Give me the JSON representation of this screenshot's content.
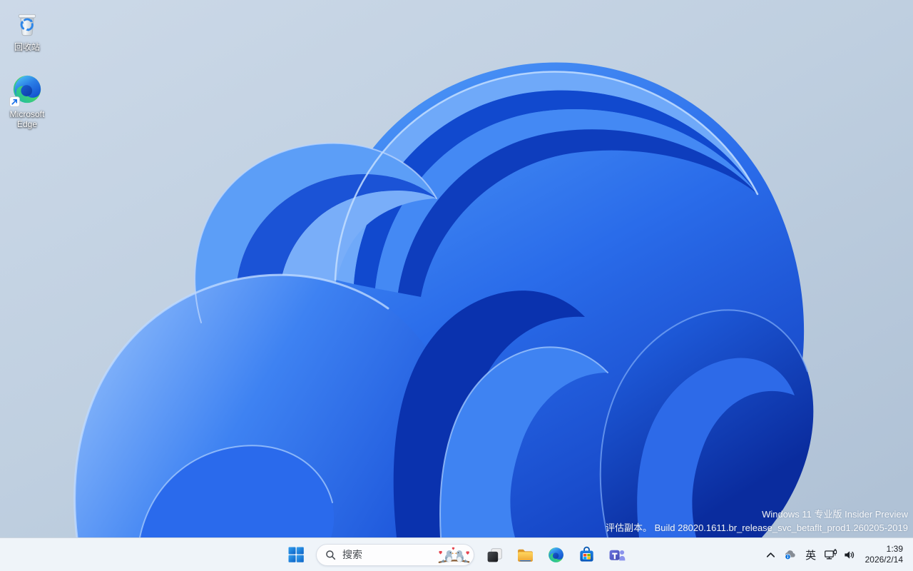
{
  "desktop": {
    "icons": [
      {
        "id": "recycle-bin",
        "label": "回收站"
      },
      {
        "id": "microsoft-edge",
        "label": "Microsoft Edge"
      }
    ],
    "watermark": {
      "line1": "Windows 11 专业版 Insider Preview",
      "line2": "评估副本。 Build 28020.1611.br_release_svc_betaflt_prod1.260205-2019"
    }
  },
  "taskbar": {
    "start": {
      "icon": "windows-logo"
    },
    "search": {
      "label": "搜索",
      "icons": [
        "magnifier-icon",
        "valentine-lovebirds-illustration"
      ]
    },
    "apps": [
      {
        "name": "task-view"
      },
      {
        "name": "file-explorer"
      },
      {
        "name": "microsoft-edge"
      },
      {
        "name": "microsoft-store"
      },
      {
        "name": "microsoft-teams"
      }
    ],
    "tray": {
      "chevron": "hidden-icons-chevron",
      "onedrive": "onedrive-cloud-icon",
      "ime_label": "英",
      "network": "ethernet-network-icon",
      "volume": "speaker-icon",
      "clock": {
        "time": "1:39",
        "date": "2026/2/14"
      }
    }
  },
  "colors": {
    "accent": "#0078d4",
    "taskbar_bg": "#f1f5fa",
    "wallpaper_bg_top": "#cbd8e7",
    "wallpaper_bg_bottom": "#b0c2d6",
    "bloom_bright": "#3e82f2",
    "bloom_dark": "#0a2d9e",
    "watermark_text": "#ffffff"
  }
}
